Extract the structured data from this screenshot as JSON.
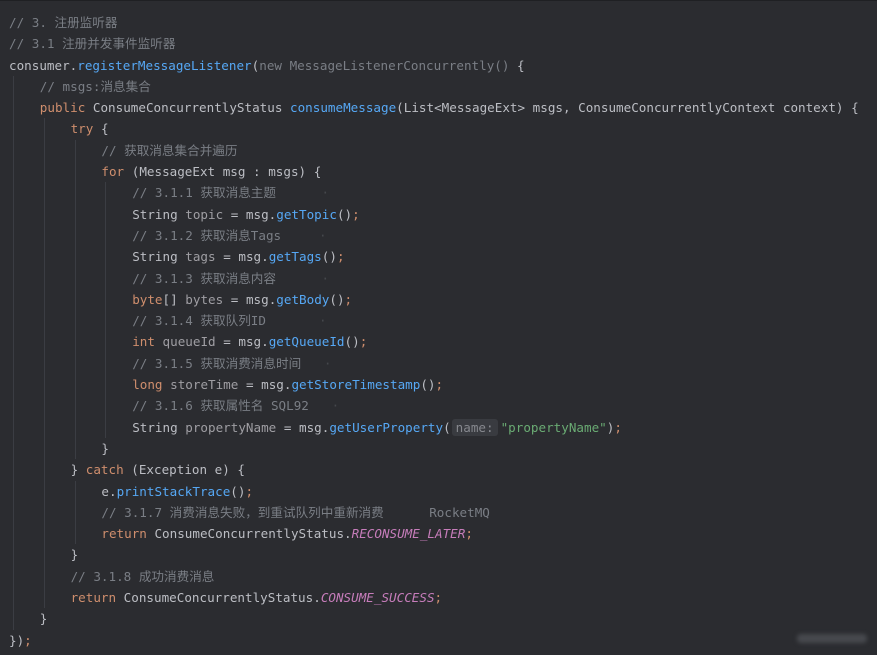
{
  "theme": {
    "background": "#2b2c30",
    "comment": "#7a7e85",
    "plain": "#bcbec4",
    "keyword": "#cf8e6d",
    "method": "#56a8f5",
    "variable": "#9f9ea3",
    "string": "#6aab73",
    "constant": "#c77dbb"
  },
  "code_lines": [
    {
      "indent": 0,
      "tokens": [
        {
          "t": "comment",
          "v": "// 3. 注册监听器"
        }
      ]
    },
    {
      "indent": 0,
      "tokens": [
        {
          "t": "comment",
          "v": "// 3.1 注册并发事件监听器"
        }
      ]
    },
    {
      "indent": 0,
      "tokens": [
        {
          "t": "plain",
          "v": "consumer."
        },
        {
          "t": "method",
          "v": "registerMessageListener"
        },
        {
          "t": "plain",
          "v": "("
        },
        {
          "t": "comment",
          "v": "new MessageListenerConcurrently() "
        },
        {
          "t": "plain",
          "v": "{"
        }
      ]
    },
    {
      "indent": 1,
      "tokens": [
        {
          "t": "comment",
          "v": "// msgs:消息集合"
        }
      ]
    },
    {
      "indent": 1,
      "tokens": [
        {
          "t": "keyword",
          "v": "public "
        },
        {
          "t": "plain",
          "v": "ConsumeConcurrentlyStatus "
        },
        {
          "t": "decl",
          "v": "consumeMessage"
        },
        {
          "t": "plain",
          "v": "(List<MessageExt> msgs, ConsumeConcurrentlyContext context) {"
        }
      ]
    },
    {
      "indent": 2,
      "tokens": [
        {
          "t": "keyword",
          "v": "try "
        },
        {
          "t": "plain",
          "v": "{"
        }
      ]
    },
    {
      "indent": 3,
      "tokens": [
        {
          "t": "comment",
          "v": "// 获取消息集合并遍历"
        }
      ]
    },
    {
      "indent": 3,
      "tokens": [
        {
          "t": "keyword",
          "v": "for "
        },
        {
          "t": "plain",
          "v": "(MessageExt msg : msgs) {"
        }
      ]
    },
    {
      "indent": 4,
      "tokens": [
        {
          "t": "comment",
          "v": "// 3.1.1 获取消息主题"
        },
        {
          "t": "wm",
          "v": "      ·"
        }
      ]
    },
    {
      "indent": 4,
      "tokens": [
        {
          "t": "plain",
          "v": "String "
        },
        {
          "t": "var",
          "v": "topic"
        },
        {
          "t": "plain",
          "v": " = msg."
        },
        {
          "t": "method",
          "v": "getTopic"
        },
        {
          "t": "plain",
          "v": "()"
        },
        {
          "t": "keyword",
          "v": ";"
        }
      ]
    },
    {
      "indent": 4,
      "tokens": [
        {
          "t": "comment",
          "v": "// 3.1.2 获取消息Tags"
        },
        {
          "t": "wm",
          "v": "     ·"
        }
      ]
    },
    {
      "indent": 4,
      "tokens": [
        {
          "t": "plain",
          "v": "String "
        },
        {
          "t": "var",
          "v": "tags"
        },
        {
          "t": "plain",
          "v": " = msg."
        },
        {
          "t": "method",
          "v": "getTags"
        },
        {
          "t": "plain",
          "v": "()"
        },
        {
          "t": "keyword",
          "v": ";"
        }
      ]
    },
    {
      "indent": 4,
      "tokens": [
        {
          "t": "comment",
          "v": "// 3.1.3 获取消息内容"
        },
        {
          "t": "wm",
          "v": "      ·"
        }
      ]
    },
    {
      "indent": 4,
      "tokens": [
        {
          "t": "keyword",
          "v": "byte"
        },
        {
          "t": "plain",
          "v": "[] "
        },
        {
          "t": "var",
          "v": "bytes"
        },
        {
          "t": "plain",
          "v": " = msg."
        },
        {
          "t": "method",
          "v": "getBody"
        },
        {
          "t": "plain",
          "v": "()"
        },
        {
          "t": "keyword",
          "v": ";"
        }
      ]
    },
    {
      "indent": 4,
      "tokens": [
        {
          "t": "comment",
          "v": "// 3.1.4 获取队列ID"
        },
        {
          "t": "wm",
          "v": "       ·"
        }
      ]
    },
    {
      "indent": 4,
      "tokens": [
        {
          "t": "keyword",
          "v": "int "
        },
        {
          "t": "var",
          "v": "queueId"
        },
        {
          "t": "plain",
          "v": " = msg."
        },
        {
          "t": "method",
          "v": "getQueueId"
        },
        {
          "t": "plain",
          "v": "()"
        },
        {
          "t": "keyword",
          "v": ";"
        }
      ]
    },
    {
      "indent": 4,
      "tokens": [
        {
          "t": "comment",
          "v": "// 3.1.5 获取消费消息时间"
        },
        {
          "t": "wm",
          "v": "   ·"
        }
      ]
    },
    {
      "indent": 4,
      "tokens": [
        {
          "t": "keyword",
          "v": "long "
        },
        {
          "t": "var",
          "v": "storeTime"
        },
        {
          "t": "plain",
          "v": " = msg."
        },
        {
          "t": "method",
          "v": "getStoreTimestamp"
        },
        {
          "t": "plain",
          "v": "()"
        },
        {
          "t": "keyword",
          "v": ";"
        }
      ]
    },
    {
      "indent": 4,
      "tokens": [
        {
          "t": "comment",
          "v": "// 3.1.6 获取属性名 SQL92"
        },
        {
          "t": "wm",
          "v": "   ·"
        }
      ]
    },
    {
      "indent": 4,
      "tokens": [
        {
          "t": "plain",
          "v": "String "
        },
        {
          "t": "var",
          "v": "propertyName"
        },
        {
          "t": "plain",
          "v": " = msg."
        },
        {
          "t": "method",
          "v": "getUserProperty"
        },
        {
          "t": "plain",
          "v": "("
        },
        {
          "t": "hint",
          "v": "name:"
        },
        {
          "t": "string",
          "v": "\"propertyName\""
        },
        {
          "t": "plain",
          "v": ")"
        },
        {
          "t": "keyword",
          "v": ";"
        }
      ]
    },
    {
      "indent": 3,
      "tokens": [
        {
          "t": "plain",
          "v": "}"
        }
      ]
    },
    {
      "indent": 2,
      "tokens": [
        {
          "t": "plain",
          "v": "} "
        },
        {
          "t": "keyword",
          "v": "catch "
        },
        {
          "t": "plain",
          "v": "(Exception e) {"
        }
      ]
    },
    {
      "indent": 3,
      "tokens": [
        {
          "t": "plain",
          "v": "e."
        },
        {
          "t": "method",
          "v": "printStackTrace"
        },
        {
          "t": "plain",
          "v": "()"
        },
        {
          "t": "keyword",
          "v": ";"
        }
      ]
    },
    {
      "indent": 3,
      "tokens": [
        {
          "t": "comment",
          "v": "// 3.1.7 消费消息失败，到重试队列中重新消费      RocketMQ"
        }
      ]
    },
    {
      "indent": 3,
      "tokens": [
        {
          "t": "keyword",
          "v": "return "
        },
        {
          "t": "plain",
          "v": "ConsumeConcurrentlyStatus."
        },
        {
          "t": "const",
          "v": "RECONSUME_LATER"
        },
        {
          "t": "keyword",
          "v": ";"
        }
      ]
    },
    {
      "indent": 2,
      "tokens": [
        {
          "t": "plain",
          "v": "}"
        }
      ]
    },
    {
      "indent": 2,
      "tokens": [
        {
          "t": "comment",
          "v": "// 3.1.8 成功消费消息"
        }
      ]
    },
    {
      "indent": 2,
      "tokens": [
        {
          "t": "keyword",
          "v": "return "
        },
        {
          "t": "plain",
          "v": "ConsumeConcurrentlyStatus."
        },
        {
          "t": "const",
          "v": "CONSUME_SUCCESS"
        },
        {
          "t": "keyword",
          "v": ";"
        }
      ]
    },
    {
      "indent": 1,
      "tokens": [
        {
          "t": "plain",
          "v": "}"
        }
      ]
    },
    {
      "indent": 0,
      "tokens": [
        {
          "t": "plain",
          "v": "})"
        },
        {
          "t": "keyword",
          "v": ";"
        }
      ]
    }
  ]
}
